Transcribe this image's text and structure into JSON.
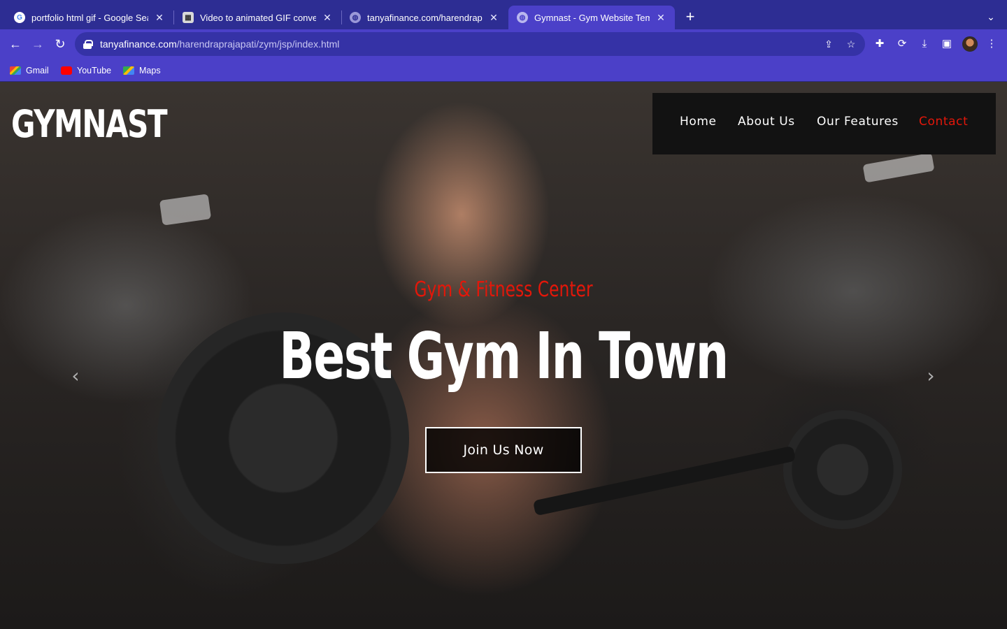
{
  "browser": {
    "tabs": [
      {
        "title": "portfolio html gif - Google Search",
        "favicon": "google-icon",
        "active": false
      },
      {
        "title": "Video to animated GIF converter",
        "favicon": "ezgif-icon",
        "active": false
      },
      {
        "title": "tanyafinance.com/harendraprajapati",
        "favicon": "globe-icon",
        "active": false
      },
      {
        "title": "Gymnast - Gym Website Template",
        "favicon": "globe-icon",
        "active": true
      }
    ],
    "new_tab_label": "+",
    "url_host": "tanyafinance.com",
    "url_path": "/harendraprajapati/zym/jsp/index.html",
    "bookmarks": [
      {
        "label": "Gmail",
        "icon": "gmail-icon"
      },
      {
        "label": "YouTube",
        "icon": "youtube-icon"
      },
      {
        "label": "Maps",
        "icon": "maps-icon"
      }
    ],
    "colors": {
      "tabbar": "#2d2d93",
      "toolbar": "#4b40c8",
      "omnibox": "#3532a6"
    }
  },
  "site": {
    "logo": "GYMNAST",
    "nav": [
      {
        "label": "Home",
        "active": false
      },
      {
        "label": "About Us",
        "active": false
      },
      {
        "label": "Our Features",
        "active": false
      },
      {
        "label": "Contact",
        "active": true
      }
    ],
    "hero": {
      "tagline": "Gym & Fitness Center",
      "headline": "Best Gym In Town",
      "cta_label": "Join Us Now"
    },
    "carousel": {
      "prev_icon": "chevron-left-icon",
      "next_icon": "chevron-right-icon"
    },
    "colors": {
      "accent": "#e3170a",
      "nav_bg": "#121212",
      "text": "#ffffff"
    }
  }
}
